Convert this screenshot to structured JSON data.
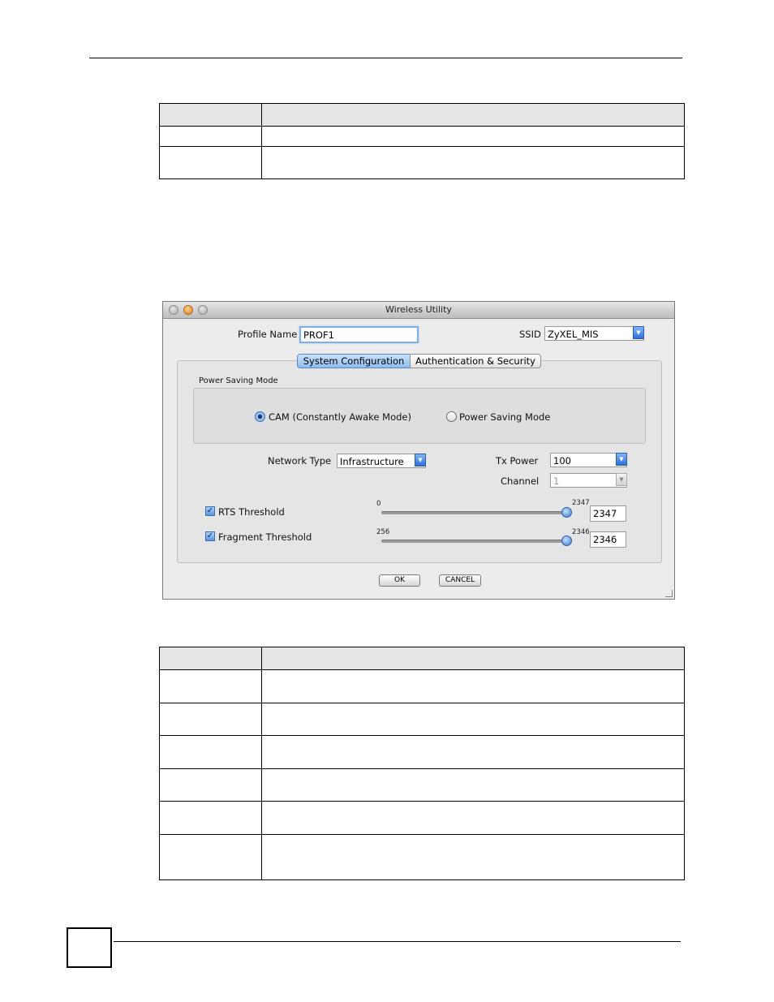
{
  "window": {
    "title": "Wireless Utility",
    "profile_name_label": "Profile Name",
    "profile_name_value": "PROF1",
    "ssid_label": "SSID",
    "ssid_value": "ZyXEL_MIS"
  },
  "tabs": [
    {
      "label": "System Configuration",
      "active": true
    },
    {
      "label": "Authentication & Security",
      "active": false
    }
  ],
  "power_saving": {
    "legend": "Power Saving Mode",
    "cam_label": "CAM (Constantly Awake Mode)",
    "cam_selected": true,
    "psm_label": "Power Saving Mode",
    "psm_selected": false
  },
  "network": {
    "network_type_label": "Network Type",
    "network_type_value": "Infrastructure",
    "tx_power_label": "Tx Power",
    "tx_power_value": "100",
    "channel_label": "Channel",
    "channel_value": "1"
  },
  "rts": {
    "label": "RTS Threshold",
    "checked": true,
    "min": "0",
    "max": "2347",
    "value": "2347"
  },
  "fragment": {
    "label": "Fragment Threshold",
    "checked": true,
    "min": "256",
    "max": "2346",
    "value": "2346"
  },
  "buttons": {
    "ok": "OK",
    "cancel": "CANCEL"
  },
  "colors": {
    "accent": "#5f97e0",
    "window_bg": "#ececec"
  }
}
